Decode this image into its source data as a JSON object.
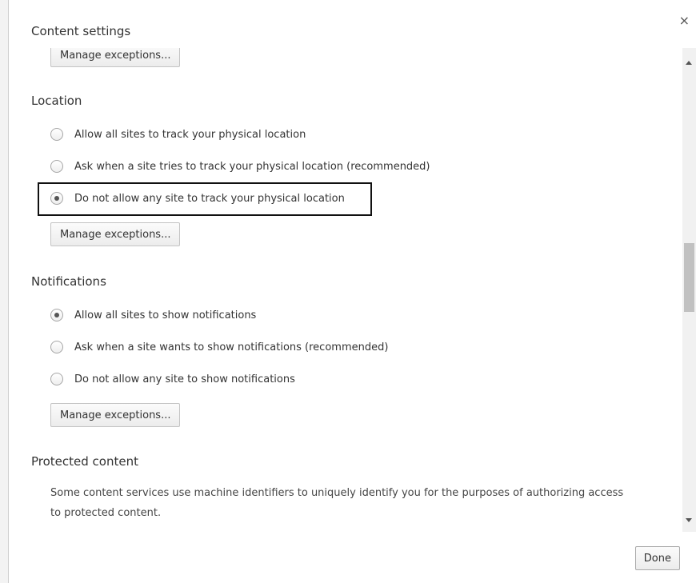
{
  "dialog": {
    "title": "Content settings",
    "close_glyph": "×",
    "done_label": "Done"
  },
  "top_section": {
    "manage_label": "Manage exceptions..."
  },
  "location": {
    "heading": "Location",
    "options": [
      {
        "label": "Allow all sites to track your physical location",
        "checked": false
      },
      {
        "label": "Ask when a site tries to track your physical location (recommended)",
        "checked": false
      },
      {
        "label": "Do not allow any site to track your physical location",
        "checked": true
      }
    ],
    "manage_label": "Manage exceptions..."
  },
  "notifications": {
    "heading": "Notifications",
    "options": [
      {
        "label": "Allow all sites to show notifications",
        "checked": true
      },
      {
        "label": "Ask when a site wants to show notifications (recommended)",
        "checked": false
      },
      {
        "label": "Do not allow any site to show notifications",
        "checked": false
      }
    ],
    "manage_label": "Manage exceptions..."
  },
  "protected_content": {
    "heading": "Protected content",
    "description_line1": "Some content services use machine identifiers to uniquely identify you for the purposes of authorizing access",
    "description_line2": "to protected content."
  },
  "icons": {
    "close": "close-icon",
    "scroll_up": "scroll-up-arrow-icon",
    "scroll_down": "scroll-down-arrow-icon"
  },
  "colors": {
    "highlight_border": "#111111",
    "text": "#333333"
  }
}
